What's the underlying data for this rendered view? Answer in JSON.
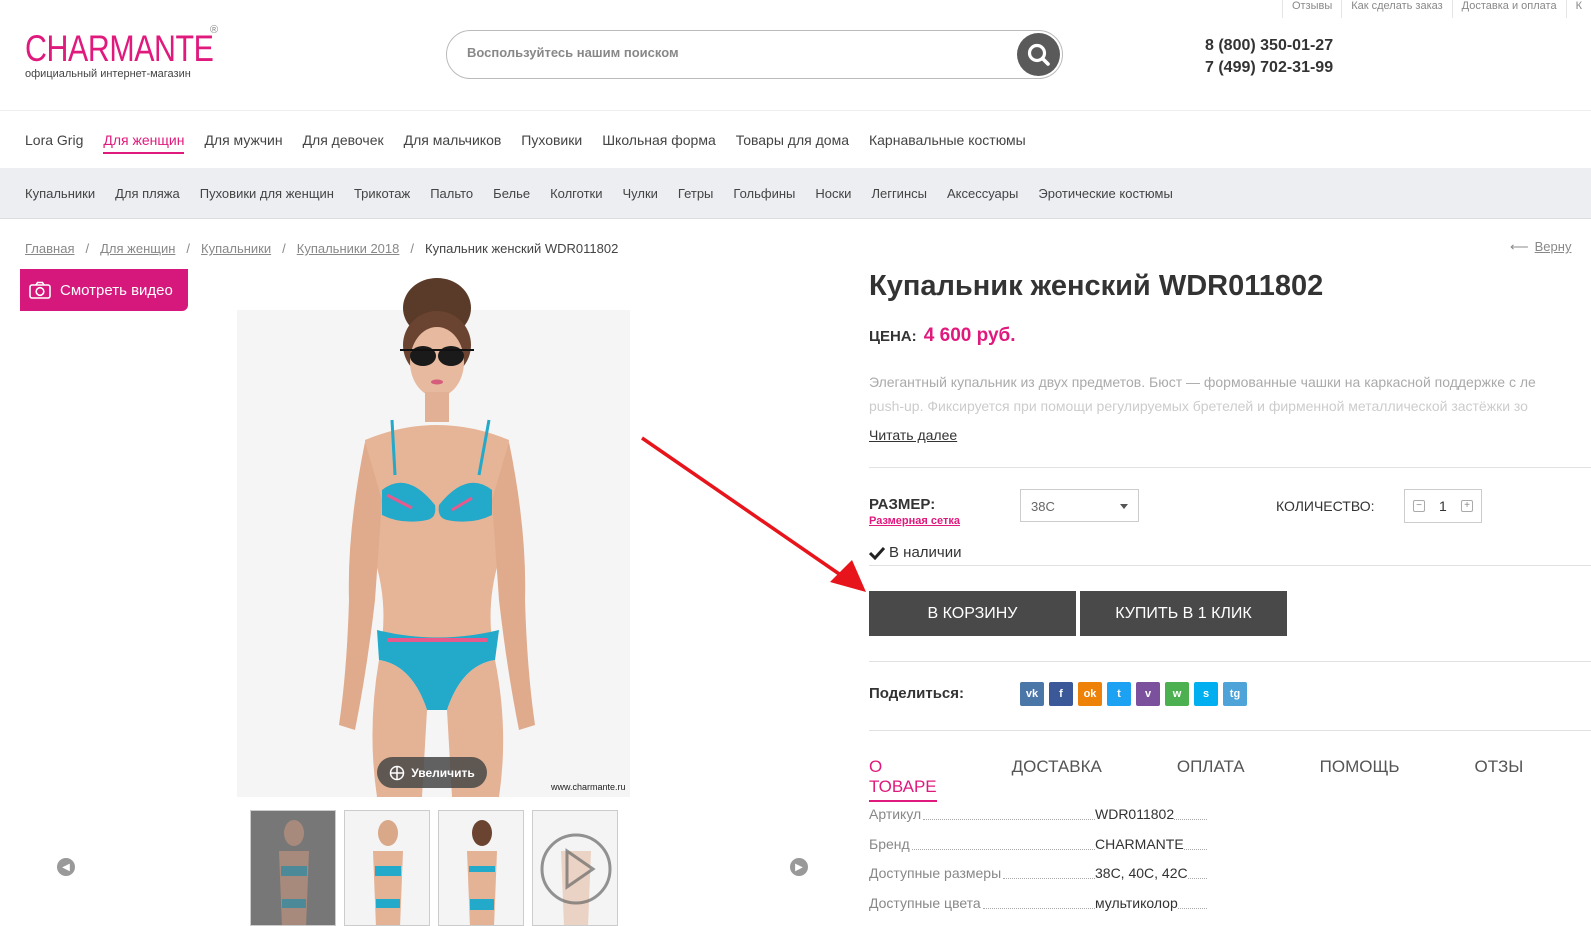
{
  "toplinks": [
    "Отзывы",
    "Как сделать заказ",
    "Доставка и оплата",
    "К"
  ],
  "logo": {
    "brand": "CHARMANTE",
    "reg": "®",
    "subtitle": "официальный интернет-магазин"
  },
  "search": {
    "placeholder": "Воспользуйтесь нашим поиском"
  },
  "phones": [
    "8 (800) 350-01-27",
    "7 (499) 702-31-99"
  ],
  "main_nav": [
    {
      "label": "Lora Grig",
      "active": false
    },
    {
      "label": "Для женщин",
      "active": true
    },
    {
      "label": "Для мужчин",
      "active": false
    },
    {
      "label": "Для девочек",
      "active": false
    },
    {
      "label": "Для мальчиков",
      "active": false
    },
    {
      "label": "Пуховики",
      "active": false
    },
    {
      "label": "Школьная форма",
      "active": false
    },
    {
      "label": "Товары для дома",
      "active": false
    },
    {
      "label": "Карнавальные костюмы",
      "active": false
    }
  ],
  "sub_nav": [
    "Купальники",
    "Для пляжа",
    "Пуховики для женщин",
    "Трикотаж",
    "Пальто",
    "Белье",
    "Колготки",
    "Чулки",
    "Гетры",
    "Гольфины",
    "Носки",
    "Леггинсы",
    "Аксессуары",
    "Эротические костюмы"
  ],
  "breadcrumb": [
    "Главная",
    "Для женщин",
    "Купальники",
    "Купальники 2018"
  ],
  "breadcrumb_current": "Купальник женский WDR011802",
  "breadcrumb_sep": "/",
  "back_link": "Верну",
  "video_button": "Смотреть видео",
  "zoom_button": "Увеличить",
  "watermark": "www.charmante.ru",
  "product": {
    "title": "Купальник женский WDR011802",
    "price_label": "ЦЕНА:",
    "price_value": "4 600 руб.",
    "desc_line1": "Элегантный купальник из двух предметов. Бюст — формованные чашки на каркасной поддержке с ле",
    "desc_line2": "push-up. Фиксируется при помощи регулируемых бретелей и фирменной металлической застёжки зо",
    "read_more": "Читать далее",
    "size_label": "РАЗМЕР:",
    "size_grid_link": "Размерная сетка",
    "size_selected": "38C",
    "qty_label": "КОЛИЧЕСТВО:",
    "qty_value": "1",
    "stock": "В наличии",
    "cart_button": "В КОРЗИНУ",
    "oneclick_button": "КУПИТЬ В 1 КЛИК",
    "share_label": "Поделиться:"
  },
  "share_icons": [
    {
      "name": "vk-icon",
      "glyph": "vk",
      "color": "#4a76a8"
    },
    {
      "name": "facebook-icon",
      "glyph": "f",
      "color": "#3b5998"
    },
    {
      "name": "odnoklassniki-icon",
      "glyph": "ok",
      "color": "#ee8208"
    },
    {
      "name": "twitter-icon",
      "glyph": "t",
      "color": "#1da1f2"
    },
    {
      "name": "viber-icon",
      "glyph": "v",
      "color": "#7b519d"
    },
    {
      "name": "whatsapp-icon",
      "glyph": "w",
      "color": "#4caf50"
    },
    {
      "name": "skype-icon",
      "glyph": "s",
      "color": "#00aff0"
    },
    {
      "name": "telegram-icon",
      "glyph": "tg",
      "color": "#4ea4d9"
    }
  ],
  "tabs": [
    {
      "label": "О ТОВАРЕ",
      "active": true
    },
    {
      "label": "ДОСТАВКА",
      "active": false
    },
    {
      "label": "ОПЛАТА",
      "active": false
    },
    {
      "label": "ПОМОЩЬ",
      "active": false
    },
    {
      "label": "ОТЗЫ",
      "active": false
    }
  ],
  "specs": [
    {
      "key": "Артикул",
      "value": "WDR011802"
    },
    {
      "key": "Бренд",
      "value": "CHARMANTE"
    },
    {
      "key": "Доступные размеры",
      "value": "38C, 40C, 42C"
    },
    {
      "key": "Доступные цвета",
      "value": "мультиколор"
    }
  ],
  "colors": {
    "accent": "#e0197d",
    "button_dark": "#494949",
    "subnav_bg": "#eceef1",
    "annotation_arrow": "#e8141b"
  }
}
